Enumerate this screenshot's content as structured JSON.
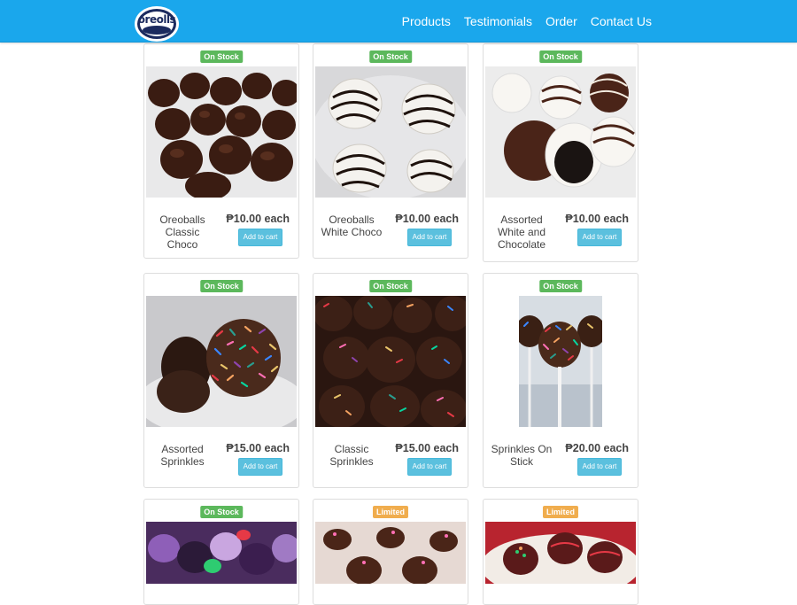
{
  "brand": {
    "logo_text": "oreolls"
  },
  "nav": [
    {
      "label": "Products"
    },
    {
      "label": "Testimonials"
    },
    {
      "label": "Order"
    },
    {
      "label": "Contact Us"
    }
  ],
  "currency": "₱",
  "products": [
    {
      "status": "On Stock",
      "status_color": "#5cb85c",
      "name": "Oreoballs Classic Choco",
      "price": "₱10.00 each",
      "button": "Add to cart"
    },
    {
      "status": "On Stock",
      "status_color": "#5cb85c",
      "name": "Oreoballs White Choco",
      "price": "₱10.00 each",
      "button": "Add to cart"
    },
    {
      "status": "On Stock",
      "status_color": "#5cb85c",
      "name": "Assorted White and Chocolate",
      "price": "₱10.00 each",
      "button": "Add to cart"
    },
    {
      "status": "On Stock",
      "status_color": "#5cb85c",
      "name": "Assorted Sprinkles",
      "price": "₱15.00 each",
      "button": "Add to cart"
    },
    {
      "status": "On Stock",
      "status_color": "#5cb85c",
      "name": "Classic Sprinkles",
      "price": "₱15.00 each",
      "button": "Add to cart"
    },
    {
      "status": "On Stock",
      "status_color": "#5cb85c",
      "name": "Sprinkles On Stick",
      "price": "₱20.00 each",
      "button": "Add to cart"
    },
    {
      "status": "On Stock",
      "status_color": "#5cb85c"
    },
    {
      "status": "Limited",
      "status_color": "#f0ad4e"
    },
    {
      "status": "Limited",
      "status_color": "#f0ad4e"
    }
  ],
  "colors": {
    "navbar": "#1aa7ec",
    "button": "#5bc0de",
    "in_stock": "#5cb85c",
    "limited": "#f0ad4e"
  }
}
